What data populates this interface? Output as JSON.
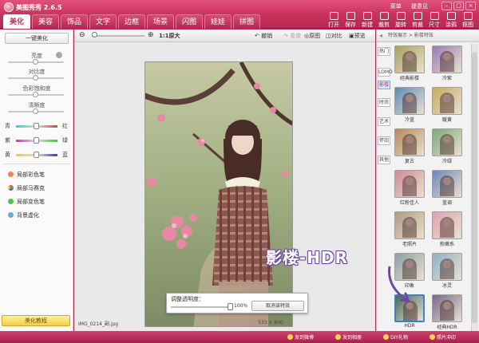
{
  "app": {
    "title": "美图秀秀 2.6.5"
  },
  "tabs": [
    "美化",
    "美容",
    "饰品",
    "文字",
    "边框",
    "场景",
    "闪图",
    "娃娃",
    "拼图"
  ],
  "top_links": [
    "菜单",
    "提意见"
  ],
  "toolbar_right": [
    "打开",
    "保存",
    "新建",
    "裁剪",
    "旋转",
    "剪裁",
    "尺寸",
    "涂鸦",
    "抠图"
  ],
  "left": {
    "onekey": "一键美化",
    "sliders": [
      "亮度",
      "对比度",
      "色彩饱和度",
      "清晰度"
    ],
    "color_labels": [
      [
        "青",
        "红"
      ],
      [
        "紫",
        "绿"
      ],
      [
        "黄",
        "蓝"
      ]
    ],
    "tools": [
      "局部彩色笔",
      "局部马赛克",
      "局部变色笔",
      "背景虚化"
    ],
    "tutorial": "美化教程"
  },
  "center_toolbar": {
    "zoom": "1:1原大",
    "undo": "撤销",
    "redo": "重做",
    "original": "原图",
    "compare": "对比",
    "preview": "预览"
  },
  "image": {
    "filename": "IMG_0214_副.jpg",
    "size": "533 × 800"
  },
  "opacity_popup": {
    "label": "调整透明度：",
    "value": "100%",
    "cancel": "取消该特效"
  },
  "right": {
    "header": "特效展示 > 影楼特效",
    "side_tabs": [
      "热门",
      "LOMO",
      "影楼",
      "时尚",
      "艺术",
      "怀旧",
      "其他"
    ],
    "effects": [
      "经典影楼",
      "冷紫",
      "冷蓝",
      "暖黄",
      "复古",
      "冷绿",
      "红粉佳人",
      "蓝调",
      "老照片",
      "粉嫩系",
      "印象",
      "冰灵",
      "HDR",
      "经典HDR"
    ],
    "selected": "HDR"
  },
  "status": {
    "items": [
      "发到微博",
      "发到相册",
      "DIY礼物",
      "照片冲印"
    ]
  },
  "annotation": "影楼-HDR",
  "colors": {
    "brand": "#c8325c",
    "selection": "#3d7fd1",
    "annotation": "#6a4aa0"
  }
}
